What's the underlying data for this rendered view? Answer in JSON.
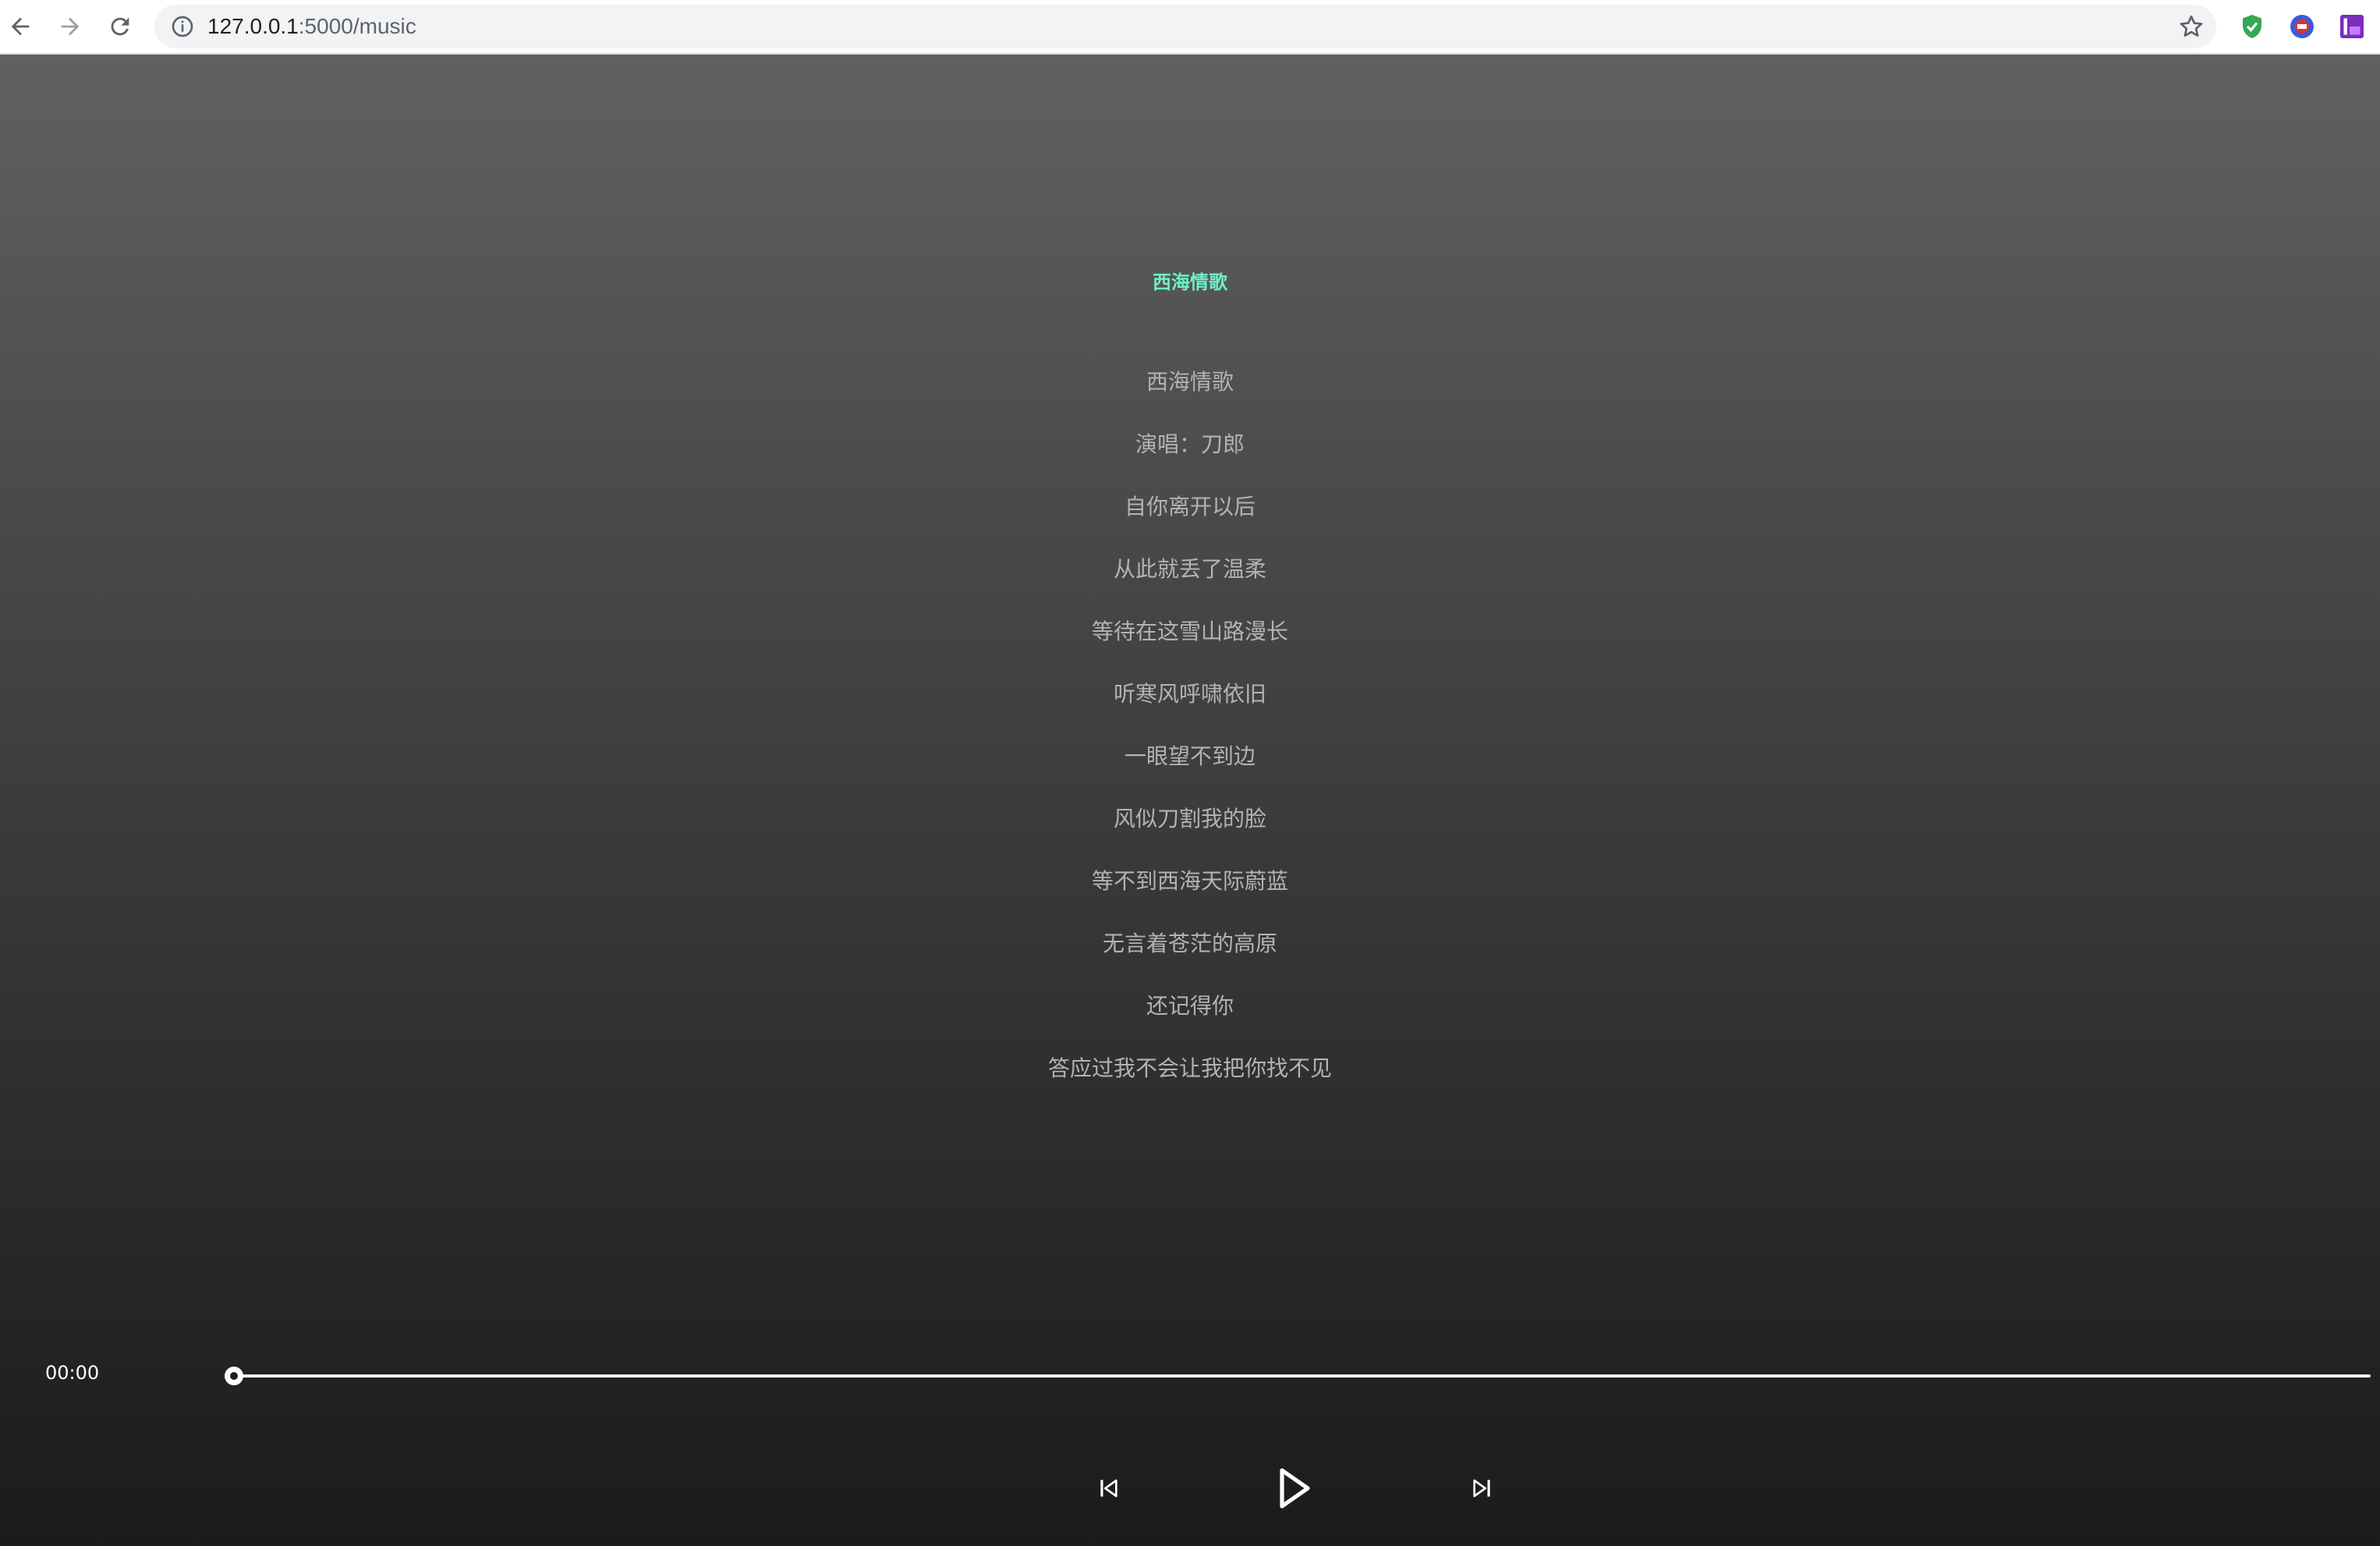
{
  "browser": {
    "url_host": "127.0.0.1",
    "url_path": ":5000/music"
  },
  "player": {
    "song_title": "西海情歌",
    "lyrics": [
      "西海情歌",
      "演唱：刀郎",
      "自你离开以后",
      "从此就丢了温柔",
      "等待在这雪山路漫长",
      "听寒风呼啸依旧",
      "一眼望不到边",
      "风似刀割我的脸",
      "等不到西海天际蔚蓝",
      "无言着苍茫的高原",
      "还记得你",
      "答应过我不会让我把你找不见"
    ],
    "current_time": "00:00",
    "progress": 0,
    "controls": {
      "previous_icon": "skip-previous-icon",
      "play_icon": "play-icon",
      "next_icon": "skip-next-icon"
    }
  },
  "colors": {
    "title_accent": "#6cf0c8",
    "lyric_text": "#b3b3b3",
    "background_top": "#616161",
    "background_bottom": "#1b1b1b"
  }
}
